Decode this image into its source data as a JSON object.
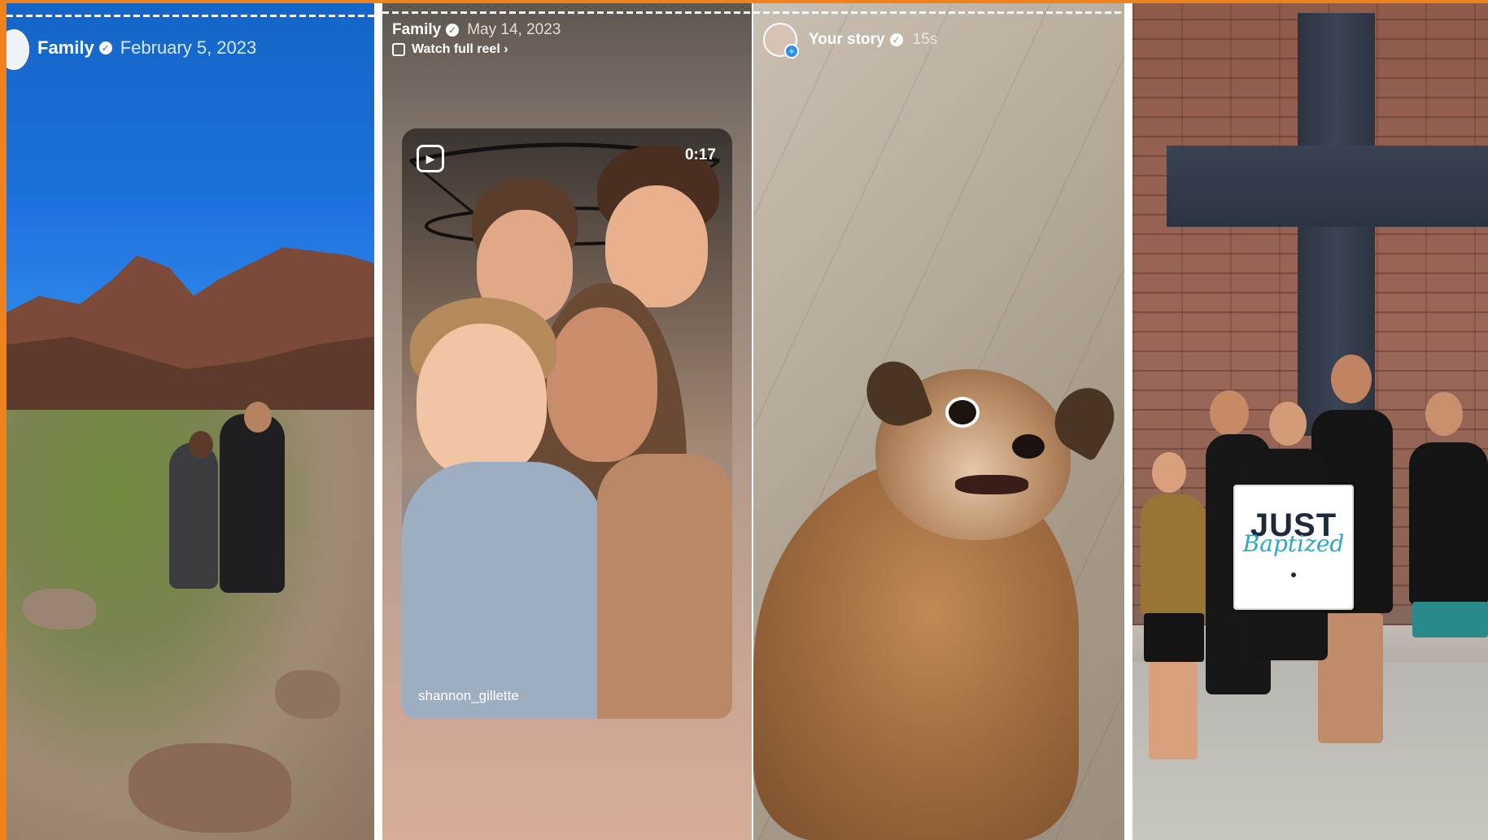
{
  "panels": [
    {
      "account": "Family",
      "date": "February 5, 2023"
    },
    {
      "account": "Family",
      "date": "May 14, 2023",
      "watch_full_reel": "Watch full reel ›",
      "reel_duration": "0:17",
      "reel_username": "shannon_gillette"
    },
    {
      "account": "Your story",
      "duration": "15s"
    },
    {
      "sign_line1": "JUST",
      "sign_line2": "Baptized"
    }
  ],
  "icons": {
    "verified": "verified-badge-icon",
    "reel": "reel-icon",
    "add_story": "plus-icon"
  },
  "colors": {
    "frame_accent": "#f0821e",
    "panel1_header": "#1a6fd6"
  }
}
